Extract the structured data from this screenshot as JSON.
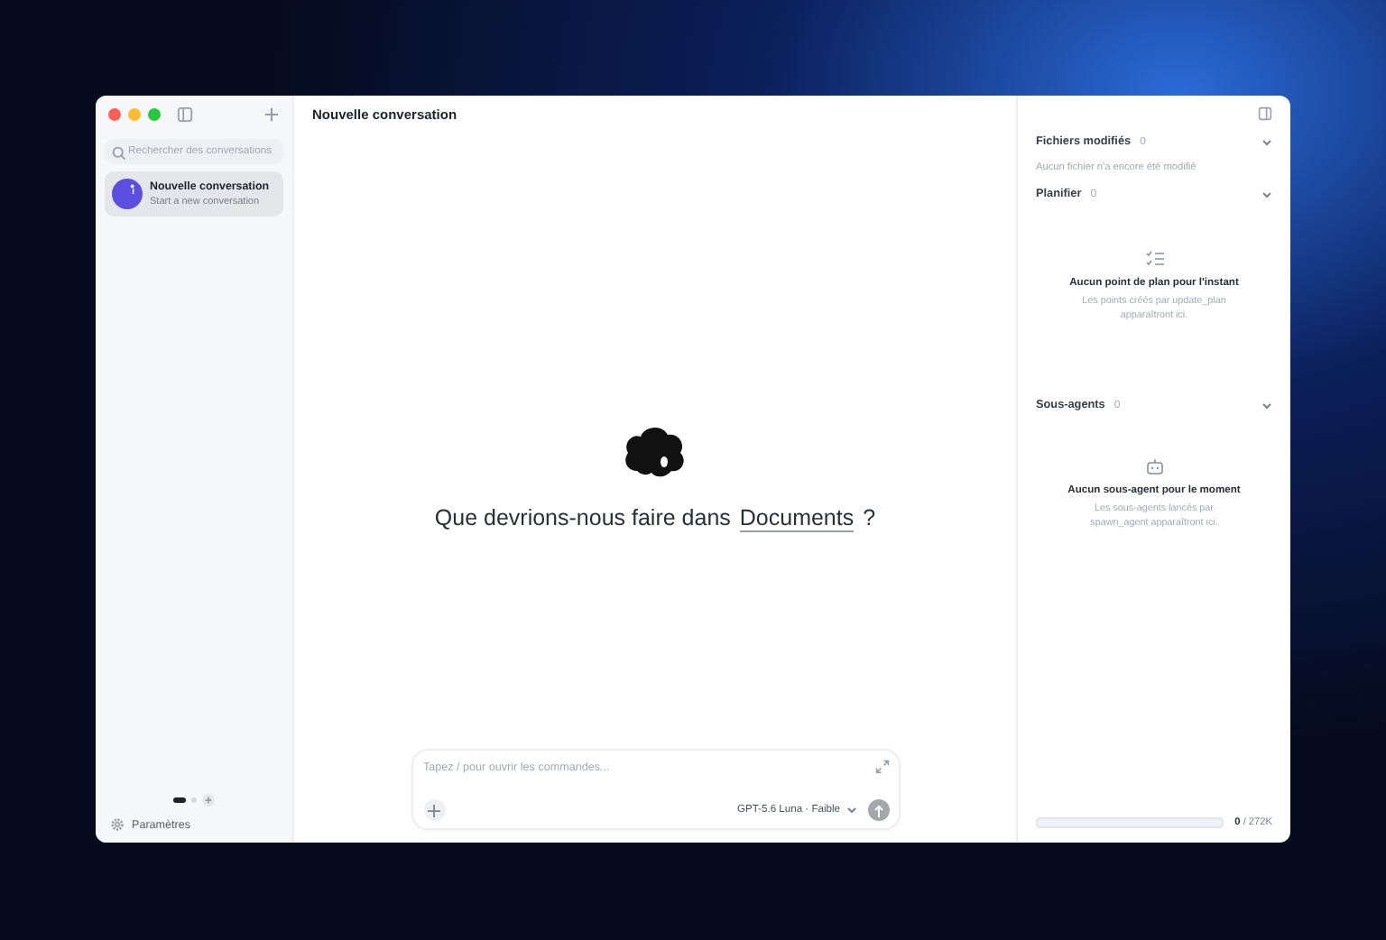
{
  "sidebar": {
    "search": {
      "placeholder": "Rechercher des conversations"
    },
    "conversations": [
      {
        "title": "Nouvelle conversation",
        "subtitle": "Start a new conversation",
        "selected": true
      }
    ],
    "page_dots": [
      {
        "selected": true
      },
      {
        "selected": false
      }
    ],
    "settings": "Paramètres"
  },
  "main": {
    "title": "Nouvelle conversation",
    "prompt_before": "Que devrions-nous faire dans",
    "folder": "Documents",
    "prompt_after": "?",
    "composer": {
      "placeholder": "Tapez / pour ouvrir les commandes...",
      "model": "GPT-5.6 Luna · Faible"
    }
  },
  "panel": {
    "sections": [
      {
        "title": "Fichiers modifiés",
        "count": "0",
        "kind": "list",
        "empty": "Aucun fichier n'a encore été modifié"
      },
      {
        "title": "Planifier",
        "count": "0",
        "kind": "plan",
        "empty_title": "Aucun point de plan pour l'instant",
        "empty": "Les points créés par update_plan apparaîtront ici."
      },
      {
        "title": "Sous-agents",
        "count": "0",
        "kind": "agents",
        "empty_title": "Aucun sous-agent pour le moment",
        "empty": "Les sous-agents lancés par spawn_agent apparaîtront ici."
      }
    ],
    "usage": {
      "level": 0,
      "reading": "**0** / 272K"
    }
  }
}
